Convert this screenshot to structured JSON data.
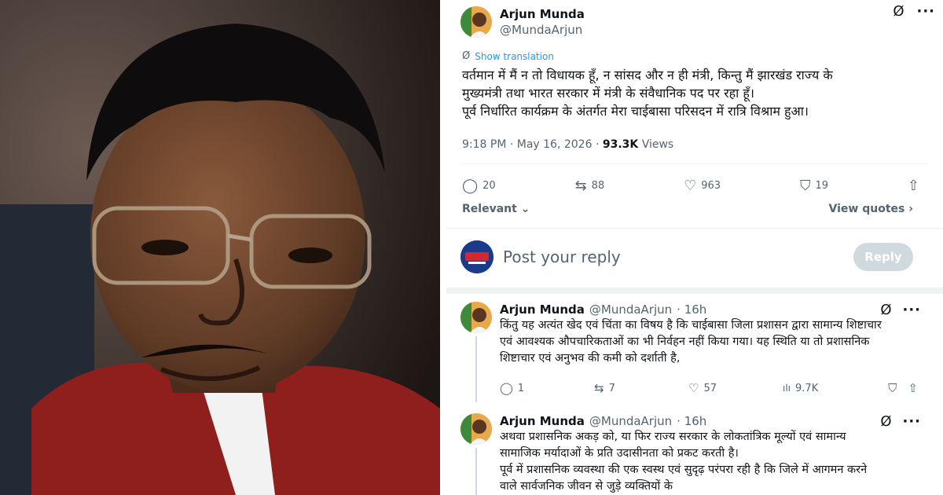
{
  "main_tweet": {
    "author_name": "Arjun Munda",
    "author_handle": "@MundaArjun",
    "translate_label": "Show translation",
    "text_lines": [
      "वर्तमान में मैं न तो विधायक हूँ, न सांसद और न ही मंत्री, किन्तु मैं झारखंड राज्य के",
      "मुख्यमंत्री तथा भारत सरकार में मंत्री के संवैधानिक पद पर रहा हूँ।",
      "पूर्व निर्धारित कार्यक्रम के अंतर्गत मेरा चाईबासा परिसदन में रात्रि विश्राम हुआ।"
    ],
    "timestamp": "9:18 PM · May 16, 2026 · ",
    "views_count": "93.3K",
    "views_label": " Views",
    "replies": "20",
    "reposts": "88",
    "likes": "963",
    "bookmarks": "19",
    "relevant_label": "Relevant",
    "view_quotes_label": "View quotes"
  },
  "reply_composer": {
    "placeholder": "Post your reply",
    "button_label": "Reply"
  },
  "replies": [
    {
      "author_name": "Arjun Munda",
      "author_handle": "@MundaArjun",
      "time": "· 16h",
      "lines": [
        "किंतु यह अत्यंत खेद एवं चिंता का विषय है कि चाईबासा जिला प्रशासन द्वारा सामान्य शिष्टाचार",
        "एवं आवश्यक औपचारिकताओं का भी निर्वहन नहीं किया गया। यह स्थिति या तो प्रशासनिक",
        "शिष्टाचार एवं अनुभव की कमी को दर्शाती है,"
      ],
      "replies": "1",
      "reposts": "7",
      "likes": "57",
      "views": "9.7K"
    },
    {
      "author_name": "Arjun Munda",
      "author_handle": "@MundaArjun",
      "time": "· 16h",
      "lines": [
        "अथवा प्रशासनिक अकड़ को, या फिर राज्य सरकार के लोकतांत्रिक मूल्यों एवं सामान्य",
        "सामाजिक मर्यादाओं के प्रति उदासीनता को प्रकट करती है।",
        "पूर्व में प्रशासनिक व्यवस्था की एक स्वस्थ एवं सुदृढ़ परंपरा रही है कि जिले में आगमन करने",
        "वाले सार्वजनिक जीवन से जुड़े व्यक्तियों के"
      ]
    }
  ],
  "icons": {
    "grok": "Ø",
    "more": "···",
    "reply": "◯",
    "repost": "⇆",
    "like": "♡",
    "bookmark": "⛉",
    "share": "⇧",
    "views": "ılı"
  },
  "colors": {
    "accent": "#1d9bf0",
    "muted": "#536471",
    "text": "#0f1419",
    "reply_button": "#cfd9de"
  }
}
